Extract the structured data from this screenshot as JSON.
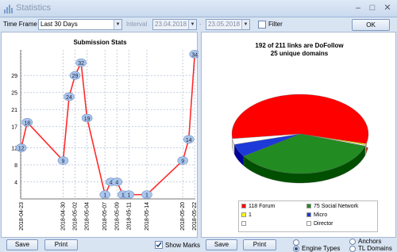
{
  "window": {
    "title": "Statistics",
    "minimize_glyph": "–",
    "maximize_glyph": "□",
    "close_glyph": "✕"
  },
  "toolbar": {
    "time_frame_label": "Time Frame",
    "time_frame_value": "Last 30 Days",
    "interval_label": "Interval",
    "date_from": "23.04.2018",
    "date_separator": "-",
    "date_to": "23.05.2018",
    "filter_label": "Filter",
    "filter_checked": false,
    "ok_label": "OK"
  },
  "left_panel": {
    "save_label": "Save",
    "print_label": "Print",
    "show_marks_label": "Show Marks",
    "show_marks_checked": true
  },
  "right_panel": {
    "save_label": "Save",
    "print_label": "Print",
    "anchors_label": "Anchors",
    "engine_types_label": "Engine Types",
    "tl_domains_label": "TL Domains"
  },
  "chart_data": [
    {
      "type": "line",
      "title": "Submission Stats",
      "x": [
        "2018-04-23",
        "2018-04-24",
        "2018-04-30",
        "2018-05-01",
        "2018-05-02",
        "2018-05-03",
        "2018-05-04",
        "2018-05-07",
        "2018-05-08",
        "2018-05-09",
        "2018-05-10",
        "2018-05-11",
        "2018-05-14",
        "2018-05-20",
        "2018-05-21",
        "2018-05-22"
      ],
      "x_tick_labels": [
        "2018-04-23",
        "2018-04-30",
        "2018-05-02",
        "2018-05-04",
        "2018-05-07",
        "2018-05-09",
        "2018-05-11",
        "2018-05-14",
        "2018-05-20",
        "2018-05-22"
      ],
      "values": [
        12,
        18,
        9,
        24,
        29,
        32,
        19,
        1,
        4,
        4,
        1,
        1,
        1,
        9,
        14,
        34
      ],
      "yticks": [
        4,
        8,
        12,
        17,
        21,
        25,
        29
      ],
      "ylim": [
        0,
        35
      ],
      "line_color": "#ff2a2a",
      "marker_color": "#a9c6ee",
      "show_marks": true
    },
    {
      "type": "pie",
      "title": "192 of 211 links are DoFollow",
      "subtitle": "25 unique domains",
      "labels": [
        "Forum",
        "Micro",
        "",
        "Social Network",
        "Micro",
        "Director"
      ],
      "values": [
        118,
        1,
        1,
        75,
        11,
        5
      ],
      "legend_text": [
        "118 Forum",
        "1",
        "",
        "75 Social Network",
        "Micro",
        "Director"
      ],
      "colors": [
        "#ff0000",
        "#ffff00",
        "#ffffff",
        "#228b22",
        "#1d3ad8",
        "#ffffff"
      ],
      "legend_placement": "bottom"
    }
  ]
}
